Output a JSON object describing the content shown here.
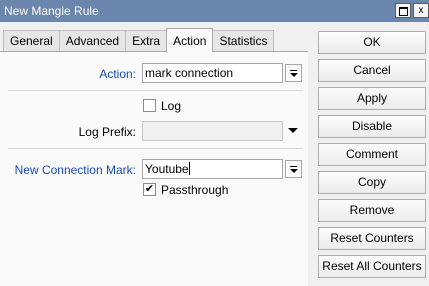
{
  "window": {
    "title": "New Mangle Rule",
    "title_btn_close": "x"
  },
  "tabs": [
    {
      "label": "General"
    },
    {
      "label": "Advanced"
    },
    {
      "label": "Extra"
    },
    {
      "label": "Action"
    },
    {
      "label": "Statistics"
    }
  ],
  "active_tab": "Action",
  "form": {
    "action_label": "Action:",
    "action_value": "mark connection",
    "log_label": "Log",
    "log_checked": false,
    "log_prefix_label": "Log Prefix:",
    "log_prefix_value": "",
    "new_connection_mark_label": "New Connection Mark:",
    "new_connection_mark_value": "Youtube",
    "passthrough_label": "Passthrough",
    "passthrough_checked": true,
    "check_glyph": "✔"
  },
  "buttons": [
    {
      "label": "OK"
    },
    {
      "label": "Cancel"
    },
    {
      "label": "Apply"
    },
    {
      "label": "Disable"
    },
    {
      "label": "Comment"
    },
    {
      "label": "Copy"
    },
    {
      "label": "Remove"
    },
    {
      "label": "Reset Counters"
    },
    {
      "label": "Reset All Counters"
    }
  ],
  "colors": {
    "titlebar": "#6b86ad",
    "highlight_label": "#1a4bb3"
  }
}
